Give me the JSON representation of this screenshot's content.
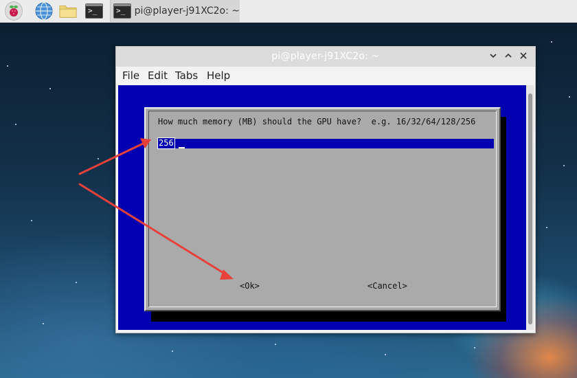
{
  "taskbar": {
    "icons": [
      "raspberry-pi-menu-icon",
      "globe-icon",
      "folder-icon",
      "terminal-icon"
    ],
    "task_button_label": "pi@player-j91XC2o: ~",
    "terminal_glyph": ">_"
  },
  "window": {
    "title": "pi@player-j91XC2o: ~",
    "menu": {
      "file": "File",
      "edit": "Edit",
      "tabs": "Tabs",
      "help": "Help"
    }
  },
  "dialog": {
    "prompt": "How much memory (MB) should the GPU have?  e.g. 16/32/64/128/256",
    "input_value": "256",
    "ok_label": "<Ok>",
    "cancel_label": "<Cancel>"
  },
  "colors": {
    "terminal_bg": "#0000b0",
    "dialog_bg": "#aaaaaa",
    "annotation_arrow": "#e8413c"
  }
}
